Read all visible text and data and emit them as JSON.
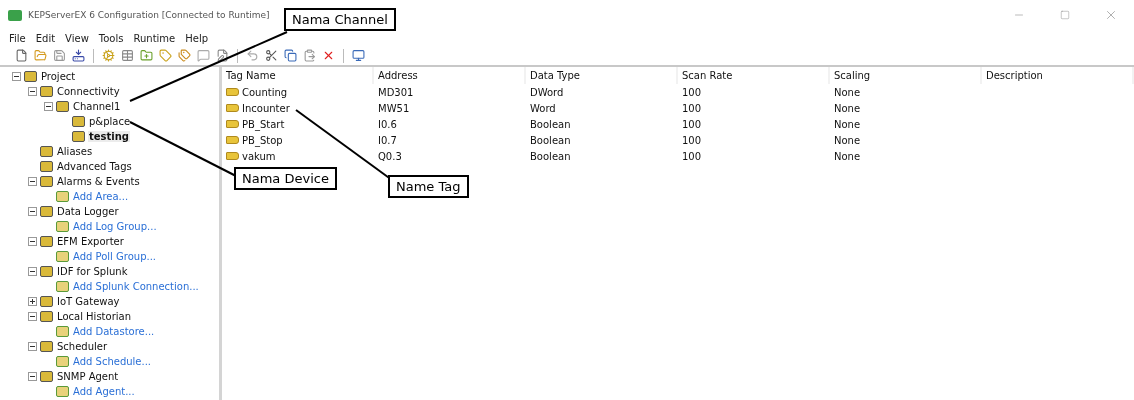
{
  "window": {
    "title": "KEPServerEX 6 Configuration [Connected to Runtime]"
  },
  "menu": [
    "File",
    "Edit",
    "View",
    "Tools",
    "Runtime",
    "Help"
  ],
  "tree": [
    {
      "label": "Project",
      "kind": "node",
      "expanded": true,
      "selected": false,
      "children": [
        {
          "label": "Connectivity",
          "kind": "node",
          "expanded": true,
          "selected": false,
          "children": [
            {
              "label": "Channel1",
              "kind": "node",
              "expanded": true,
              "selected": false,
              "children": [
                {
                  "label": "p&place",
                  "kind": "node",
                  "selected": false
                },
                {
                  "label": "testing",
                  "kind": "node",
                  "selected": true
                }
              ]
            }
          ]
        },
        {
          "label": "Aliases",
          "kind": "node",
          "selected": false
        },
        {
          "label": "Advanced Tags",
          "kind": "node",
          "selected": false
        },
        {
          "label": "Alarms & Events",
          "kind": "node",
          "expanded": true,
          "selected": false,
          "children": [
            {
              "label": "Add Area...",
              "kind": "link",
              "selected": false
            }
          ]
        },
        {
          "label": "Data Logger",
          "kind": "node",
          "expanded": true,
          "selected": false,
          "children": [
            {
              "label": "Add Log Group...",
              "kind": "link",
              "selected": false
            }
          ]
        },
        {
          "label": "EFM Exporter",
          "kind": "node",
          "expanded": true,
          "selected": false,
          "children": [
            {
              "label": "Add Poll Group...",
              "kind": "link",
              "selected": false
            }
          ]
        },
        {
          "label": "IDF for Splunk",
          "kind": "node",
          "expanded": true,
          "selected": false,
          "children": [
            {
              "label": "Add Splunk Connection...",
              "kind": "link",
              "selected": false
            }
          ]
        },
        {
          "label": "IoT Gateway",
          "kind": "node",
          "expanded": false,
          "selected": false
        },
        {
          "label": "Local Historian",
          "kind": "node",
          "expanded": true,
          "selected": false,
          "children": [
            {
              "label": "Add Datastore...",
              "kind": "link",
              "selected": false
            }
          ]
        },
        {
          "label": "Scheduler",
          "kind": "node",
          "expanded": true,
          "selected": false,
          "children": [
            {
              "label": "Add Schedule...",
              "kind": "link",
              "selected": false
            }
          ]
        },
        {
          "label": "SNMP Agent",
          "kind": "node",
          "expanded": true,
          "selected": false,
          "children": [
            {
              "label": "Add Agent...",
              "kind": "link",
              "selected": false
            }
          ]
        }
      ]
    }
  ],
  "table": {
    "columns": [
      "Tag Name",
      "Address",
      "Data Type",
      "Scan Rate",
      "Scaling",
      "Description"
    ],
    "rows": [
      [
        "Counting",
        "MD301",
        "DWord",
        "100",
        "None"
      ],
      [
        "Incounter",
        "MW51",
        "Word",
        "100",
        "None"
      ],
      [
        "PB_Start",
        "I0.6",
        "Boolean",
        "100",
        "None"
      ],
      [
        "PB_Stop",
        "I0.7",
        "Boolean",
        "100",
        "None"
      ],
      [
        "vakum",
        "Q0.3",
        "Boolean",
        "100",
        "None"
      ]
    ]
  },
  "annotations": [
    {
      "text": "Nama Channel"
    },
    {
      "text": "Nama Device"
    },
    {
      "text": "Name Tag"
    }
  ]
}
